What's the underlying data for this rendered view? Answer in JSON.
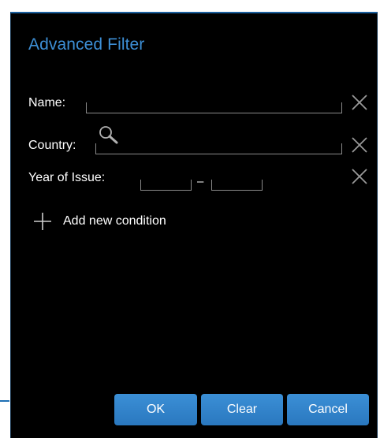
{
  "dialog": {
    "title": "Advanced Filter"
  },
  "fields": {
    "name": {
      "label": "Name:",
      "value": ""
    },
    "country": {
      "label": "Country:",
      "value": ""
    },
    "year": {
      "label": "Year of Issue:",
      "from": "",
      "to": "",
      "separator": "–"
    }
  },
  "add_condition": {
    "label": "Add new condition",
    "icon": "plus-icon"
  },
  "buttons": {
    "ok": "OK",
    "clear": "Clear",
    "cancel": "Cancel"
  },
  "colors": {
    "title": "#3d8fd6",
    "button": "#2f84cc",
    "background": "#000000",
    "border": "#1a5f9e"
  },
  "icons": {
    "clear_field": "close-icon",
    "country_search": "search-icon"
  }
}
